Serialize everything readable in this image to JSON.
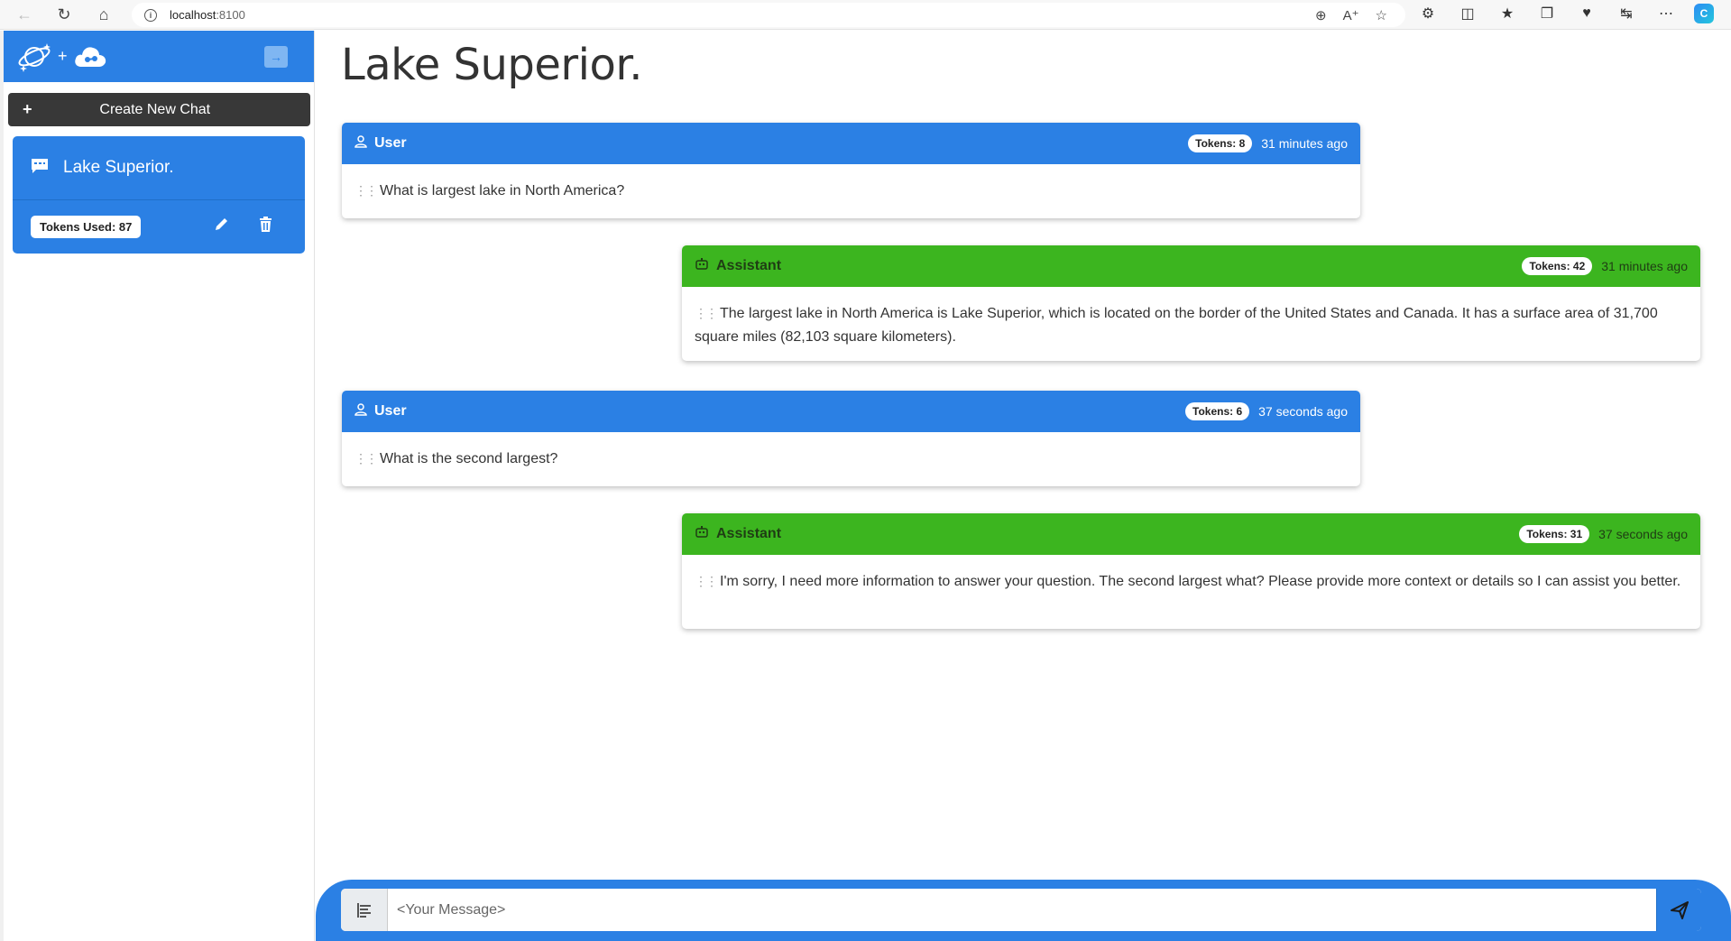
{
  "browser": {
    "url_host": "localhost",
    "url_port": ":8100"
  },
  "sidebar": {
    "new_chat_label": "Create New Chat",
    "chat": {
      "title": "Lake Superior.",
      "tokens_used": "Tokens Used: 87"
    }
  },
  "main": {
    "title": "Lake Superior.",
    "messages": [
      {
        "role": "User",
        "tokens": "Tokens: 8",
        "time": "31 minutes ago",
        "text": "What is largest lake in North America?"
      },
      {
        "role": "Assistant",
        "tokens": "Tokens: 42",
        "time": "31 minutes ago",
        "text": "The largest lake in North America is Lake Superior, which is located on the border of the United States and Canada. It has a surface area of 31,700 square miles (82,103 square kilometers)."
      },
      {
        "role": "User",
        "tokens": "Tokens: 6",
        "time": "37 seconds ago",
        "text": "What is the second largest?"
      },
      {
        "role": "Assistant",
        "tokens": "Tokens: 31",
        "time": "37 seconds ago",
        "text": "I'm sorry, I need more information to answer your question. The second largest what? Please provide more context or details so I can assist you better."
      }
    ]
  },
  "composer": {
    "placeholder": "<Your Message>"
  },
  "colors": {
    "primary": "#2b80e4",
    "assistant": "#3cb51f",
    "dark_button": "#383838"
  }
}
